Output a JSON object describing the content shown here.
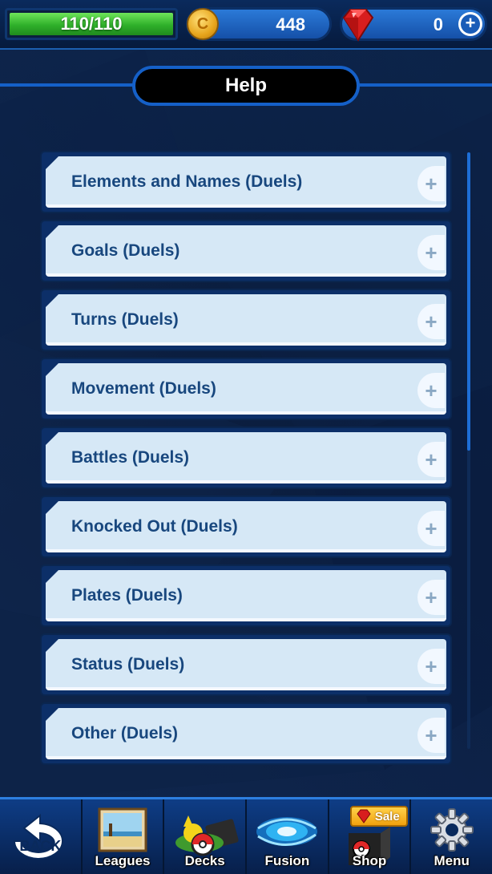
{
  "status": {
    "hp": "110/110",
    "hp_fraction": 1.0,
    "coins": "448",
    "coin_symbol": "C",
    "gems": "0",
    "plus_symbol": "+"
  },
  "screen": {
    "title": "Help"
  },
  "help_items": [
    {
      "label": "Elements and Names (Duels)",
      "expand": "+"
    },
    {
      "label": "Goals (Duels)",
      "expand": "+"
    },
    {
      "label": "Turns (Duels)",
      "expand": "+"
    },
    {
      "label": "Movement (Duels)",
      "expand": "+"
    },
    {
      "label": "Battles (Duels)",
      "expand": "+"
    },
    {
      "label": "Knocked Out (Duels)",
      "expand": "+"
    },
    {
      "label": "Plates (Duels)",
      "expand": "+"
    },
    {
      "label": "Status (Duels)",
      "expand": "+"
    },
    {
      "label": "Other (Duels)",
      "expand": "+"
    }
  ],
  "nav": {
    "back": "BACK",
    "leagues": "Leagues",
    "decks": "Decks",
    "fusion": "Fusion",
    "shop": "Shop",
    "shop_badge": "Sale",
    "menu": "Menu"
  },
  "colors": {
    "accent": "#1560c8",
    "card": "#d6e8f6",
    "card_text": "#18477e",
    "hp_green": "#2fb02a"
  }
}
